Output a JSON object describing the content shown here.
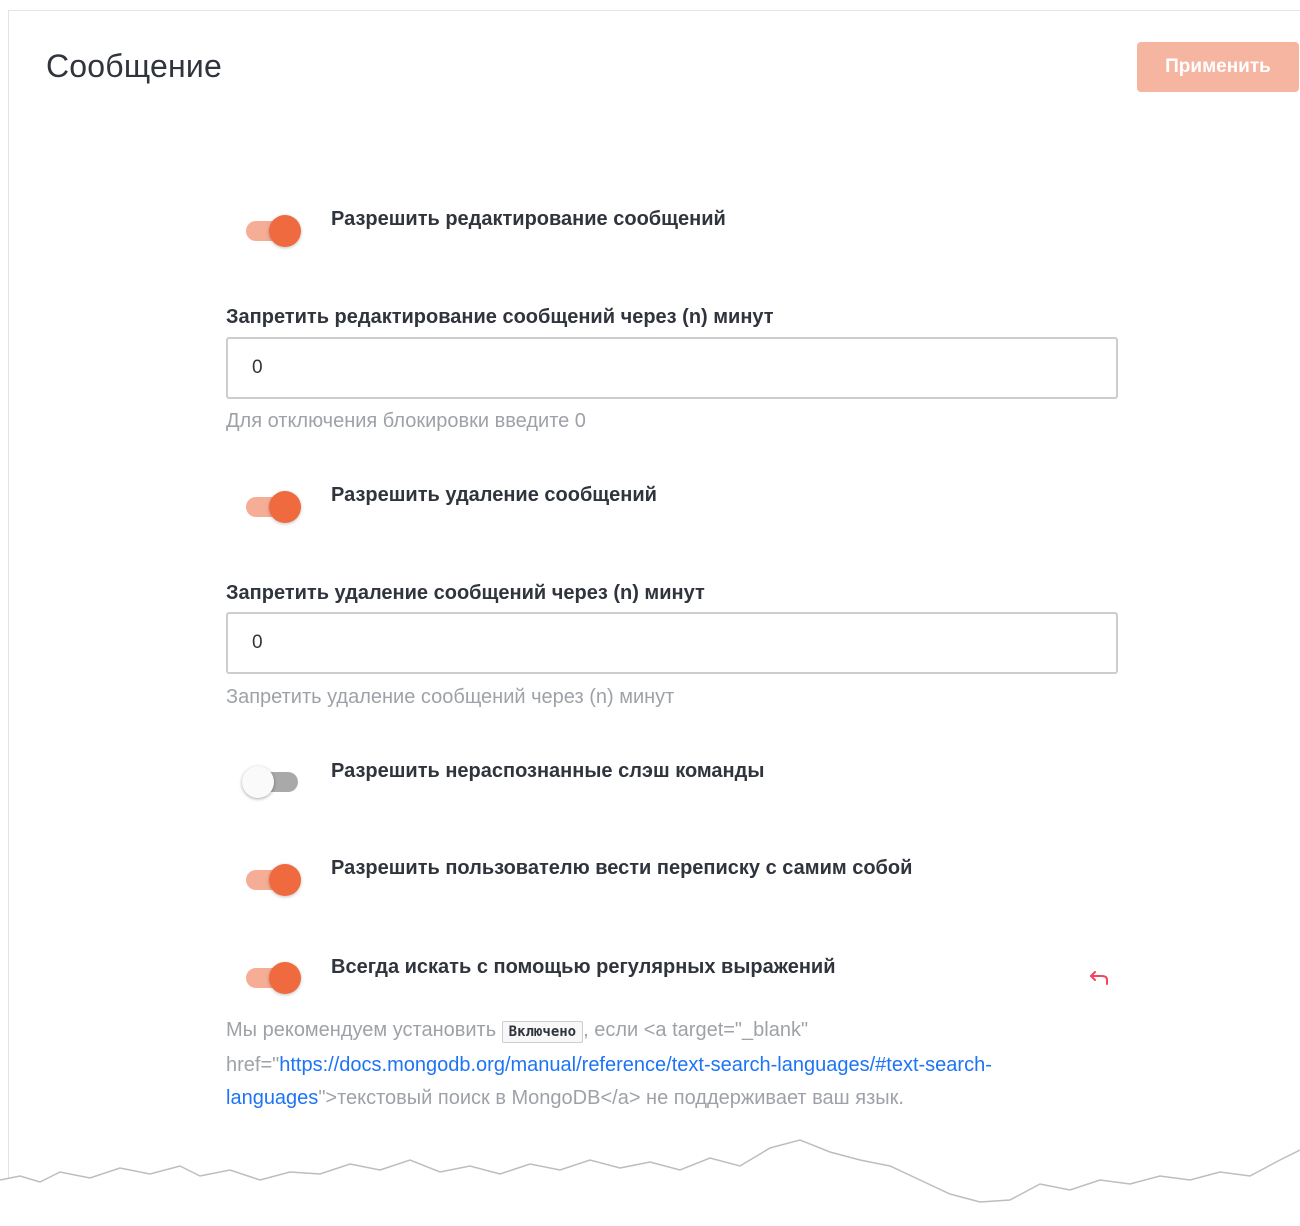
{
  "header": {
    "title": "Сообщение",
    "apply_label": "Применить"
  },
  "settings": {
    "allow_edit": {
      "label": "Разрешить редактирование сообщений",
      "enabled": true
    },
    "block_edit": {
      "label": "Запретить редактирование сообщений через (n) минут",
      "value": "0",
      "hint": "Для отключения блокировки введите 0"
    },
    "allow_delete": {
      "label": "Разрешить удаление сообщений",
      "enabled": true
    },
    "block_delete": {
      "label": "Запретить удаление сообщений через (n) минут",
      "value": "0",
      "hint": "Запретить удаление сообщений через (n) минут"
    },
    "allow_unrecognized": {
      "label": "Разрешить нераспознанные слэш команды",
      "enabled": false
    },
    "allow_self_dm": {
      "label": "Разрешить пользователю вести переписку с самим собой",
      "enabled": true
    },
    "always_regex": {
      "label": "Всегда искать с помощью регулярных выражений",
      "enabled": true
    },
    "regex_desc": {
      "part1": "Мы рекомендуем установить ",
      "code": "Включено",
      "part2": ", если <a target=\"_blank\" href=\"",
      "link": "https://docs.mongodb.org/manual/reference/text-search-languages/#text-search-languages",
      "part3": "\">текстовый поиск в MongoDB</a> не поддерживает ваш язык."
    }
  },
  "icons": {
    "reset": "undo-arrow-icon"
  },
  "colors": {
    "accent": "#ef6a3e",
    "accent_light": "#f5ad95",
    "apply_disabled": "#f5b5a0",
    "link": "#1d74f5",
    "reset": "#f5455c"
  }
}
